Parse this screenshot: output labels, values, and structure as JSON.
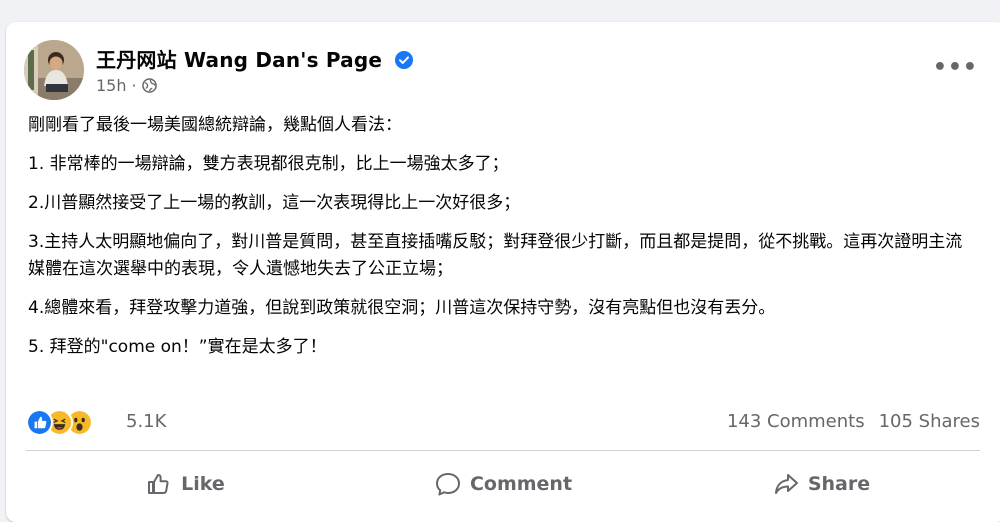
{
  "post": {
    "page_name": "王丹网站 Wang Dan's Page",
    "timestamp": "15h",
    "separator": "·",
    "audience_icon": "globe-icon",
    "paragraphs": [
      "剛剛看了最後一場美國總統辯論，幾點個人看法：",
      "1. 非常棒的一場辯論，雙方表現都很克制，比上一場強太多了；",
      "2.川普顯然接受了上一場的教訓，這一次表現得比上一次好很多；",
      "3.主持人太明顯地偏向了，對川普是質問，甚至直接插嘴反駁；對拜登很少打斷，而且都是提問，從不挑戰。這再次證明主流媒體在這次選舉中的表現，令人遺憾地失去了公正立場；",
      "4.總體來看，拜登攻擊力道強，但說到政策就很空洞；川普這次保持守勢，沒有亮點但也沒有丟分。",
      "5. 拜登的\"come on！”實在是太多了！"
    ]
  },
  "engagement": {
    "reactions": [
      "like-reaction-icon",
      "haha-reaction-icon",
      "wow-reaction-icon"
    ],
    "reaction_count": "5.1K",
    "comments": "143 Comments",
    "shares": "105 Shares"
  },
  "actions": {
    "like": "Like",
    "comment": "Comment",
    "share": "Share"
  },
  "colors": {
    "verified": "#1877f2",
    "secondary_text": "#65676b",
    "like": "#1877f2",
    "haha_wow": "#f7b928"
  }
}
